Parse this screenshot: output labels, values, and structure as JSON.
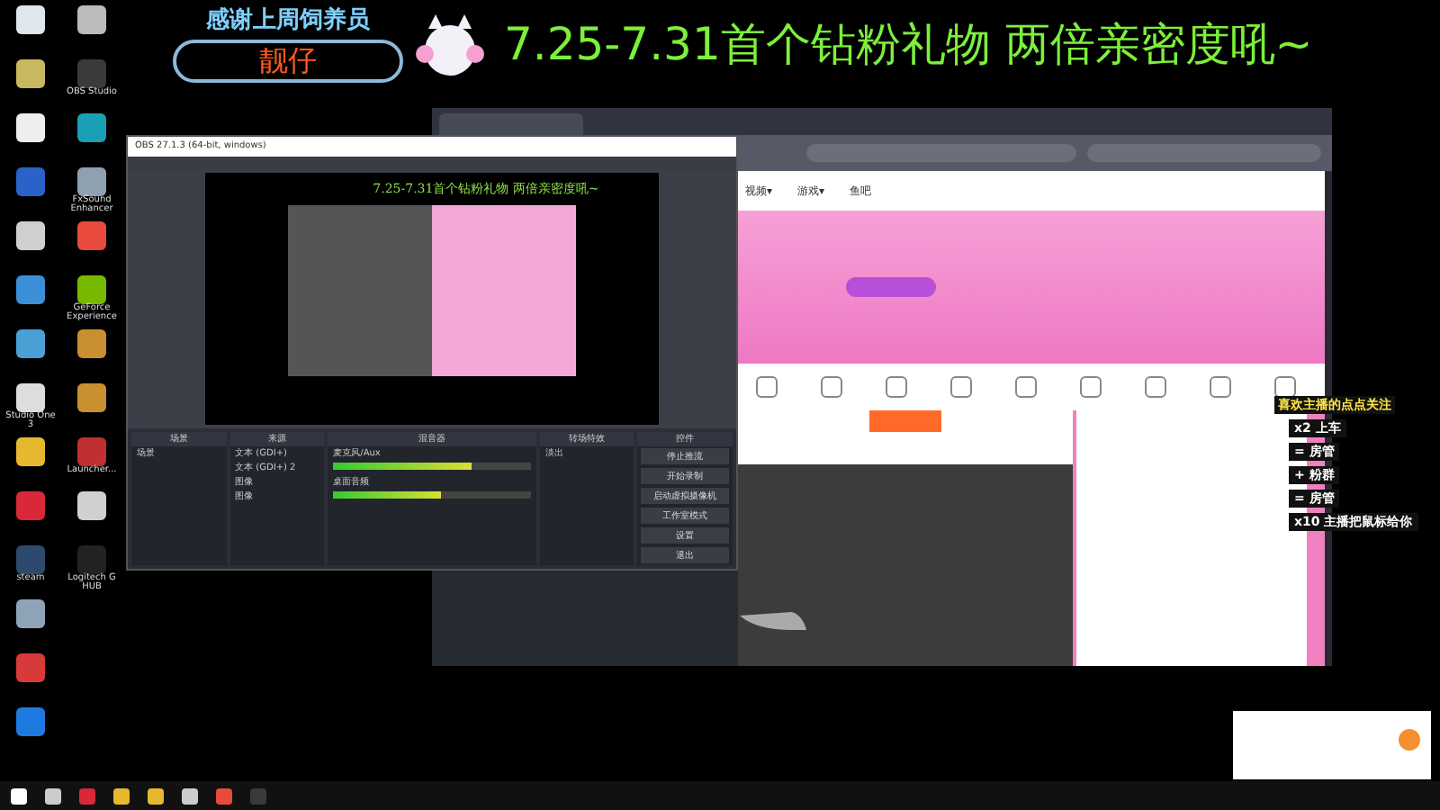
{
  "desktop_icons": {
    "column_1": [
      {
        "color": "#dfe6ee"
      },
      {
        "color": "#c8b860"
      },
      {
        "color": "#eeeeee"
      },
      {
        "color": "#2a62c9"
      },
      {
        "color": "#cfcfcf"
      },
      {
        "color": "#3a8fd6"
      },
      {
        "color": "#4a9fd6"
      },
      {
        "label": "Studio One 3",
        "color": "#dddddd"
      },
      {
        "color": "#e6b830"
      },
      {
        "color": "#d8283a"
      },
      {
        "label": "steam",
        "color": "#2c4a6e"
      },
      {
        "color": "#8fa3b8"
      },
      {
        "color": "#d83a3a"
      },
      {
        "color": "#1f7ae0"
      }
    ],
    "column_2": [
      {
        "color": "#bbbbbb"
      },
      {
        "label": "OBS Studio",
        "color": "#3a3a3a"
      },
      {
        "color": "#1aa0b5"
      },
      {
        "label": "FxSound Enhancer",
        "color": "#8fa0b0"
      },
      {
        "color": "#e84b3c"
      },
      {
        "label": "GeForce Experience",
        "color": "#76b900"
      },
      {
        "color": "#c89030"
      },
      {
        "color": "#c89030"
      },
      {
        "label": "Launcher...",
        "color": "#c03030"
      },
      {
        "color": "#d0d0d0"
      },
      {
        "label": "Logitech G HUB",
        "color": "#222222"
      }
    ]
  },
  "banner": {
    "thanks": "感谢上周饲养员",
    "name": "靓仔",
    "headline": "7.25-7.31首个钻粉礼物 两倍亲密度吼~"
  },
  "browser": {
    "nav": [
      "视频▾",
      "游戏▾",
      "鱼吧"
    ]
  },
  "obs": {
    "title": "OBS 27.1.3 (64-bit, windows)",
    "preview_headline": "7.25-7.31首个钻粉礼物 两倍亲密度吼~",
    "docks": [
      {
        "title": "场景",
        "kind": "list",
        "items": [
          "场景"
        ]
      },
      {
        "title": "来源",
        "kind": "sources",
        "items": [
          "文本 (GDI+)",
          "文本 (GDI+) 2",
          "图像",
          "图像"
        ]
      },
      {
        "title": "混音器",
        "kind": "mixer",
        "items": [
          {
            "name": "麦克风/Aux",
            "level": 0.7
          },
          {
            "name": "桌面音频",
            "level": 0.55
          }
        ]
      },
      {
        "title": "转场特效",
        "kind": "transition",
        "items": [
          "淡出"
        ]
      },
      {
        "title": "控件",
        "kind": "controls",
        "items": [
          "停止推流",
          "开始录制",
          "启动虚拟摄像机",
          "工作室模式",
          "设置",
          "退出"
        ]
      }
    ]
  },
  "overlay": {
    "title": "喜欢主播的点点关注",
    "items": [
      "x2 上车",
      "= 房管",
      "+ 粉群",
      "= 房管",
      "x10 主播把鼠标给你"
    ]
  }
}
